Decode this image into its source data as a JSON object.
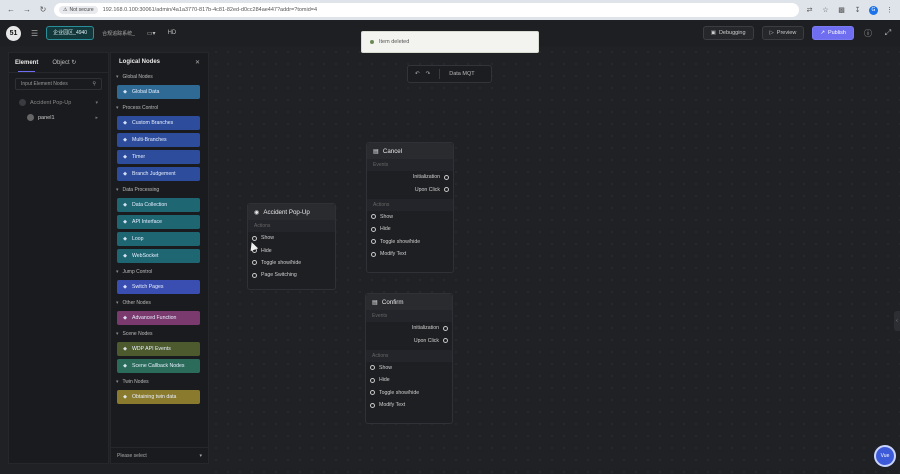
{
  "browser": {
    "back_icon": "back-icon",
    "security_label": "Not secure",
    "url": "192.168.0.100:30061/admin/4a1a3770-817b-4c81-82ed-d0cc284ae447?addr=?tomid=4"
  },
  "header": {
    "project_name": "企业园区_4940",
    "project_sub": "合规追踪系统_",
    "hd_label": "HD",
    "debugging_label": "Debugging",
    "preview_label": "Preview",
    "primary_label": "Publish"
  },
  "toast": {
    "text": "Item deleted"
  },
  "left_panel": {
    "tab_element": "Element",
    "tab_object": "Object",
    "search_placeholder": "Input Element Nodes",
    "tree": [
      {
        "label": "Accident Pop-Up"
      },
      {
        "label": "panel1"
      }
    ]
  },
  "nodes_panel": {
    "title": "Logical Nodes",
    "footer_placeholder": "Please select",
    "sections": [
      {
        "label": "Global Nodes",
        "items": [
          {
            "label": "Global Data",
            "color": "#2f6a94",
            "icon": "database-icon"
          }
        ]
      },
      {
        "label": "Process Control",
        "items": [
          {
            "label": "Custom Branches",
            "color": "#2d4d9c",
            "icon": "branch-icon"
          },
          {
            "label": "Multi-Branches",
            "color": "#2d4d9c",
            "icon": "multi-branch-icon"
          },
          {
            "label": "Timer",
            "color": "#2d4d9c",
            "icon": "timer-icon"
          },
          {
            "label": "Branch Judgement",
            "color": "#2d4d9c",
            "icon": "judgement-icon"
          }
        ]
      },
      {
        "label": "Data Processing",
        "items": [
          {
            "label": "Data Collection",
            "color": "#1f6673",
            "icon": "collection-icon"
          },
          {
            "label": "API Interface",
            "color": "#1f6673",
            "icon": "api-icon"
          },
          {
            "label": "Loop",
            "color": "#1f6673",
            "icon": "loop-icon"
          },
          {
            "label": "WebSocket",
            "color": "#1f6673",
            "icon": "websocket-icon"
          }
        ]
      },
      {
        "label": "Jump Control",
        "items": [
          {
            "label": "Switch Pages",
            "color": "#3a4db0",
            "icon": "switch-icon"
          }
        ]
      },
      {
        "label": "Other Nodes",
        "items": [
          {
            "label": "Advanced Function",
            "color": "#7a3a6e",
            "icon": "function-icon"
          }
        ]
      },
      {
        "label": "Scene Nodes",
        "items": [
          {
            "label": "WDP API Events",
            "color": "#4d5a2e",
            "icon": "api-events-icon"
          },
          {
            "label": "Scene Callback Nodes",
            "color": "#2a6b5a",
            "icon": "callback-icon"
          }
        ]
      },
      {
        "label": "Twin Nodes",
        "items": [
          {
            "label": "Obtaining twin data",
            "color": "#8a7a2e",
            "icon": "twin-icon"
          }
        ]
      }
    ]
  },
  "canvas": {
    "toolbar_label": "Data MQT",
    "nodes": {
      "accident": {
        "title": "Accident Pop-Up",
        "actions_label": "Actions",
        "actions": [
          "Show",
          "Hide",
          "Toggle show/hide",
          "Page Switching"
        ]
      },
      "cancel": {
        "title": "Cancel",
        "events_label": "Events",
        "events": [
          "Initialization",
          "Upon Click"
        ],
        "actions_label": "Actions",
        "actions": [
          "Show",
          "Hide",
          "Toggle show/hide",
          "Modify Text"
        ]
      },
      "confirm": {
        "title": "Confirm",
        "events_label": "Events",
        "events": [
          "Initialization",
          "Upon Click"
        ],
        "actions_label": "Actions",
        "actions": [
          "Show",
          "Hide",
          "Toggle show/hide",
          "Modify Text"
        ]
      }
    }
  },
  "float_button_label": "Vue"
}
